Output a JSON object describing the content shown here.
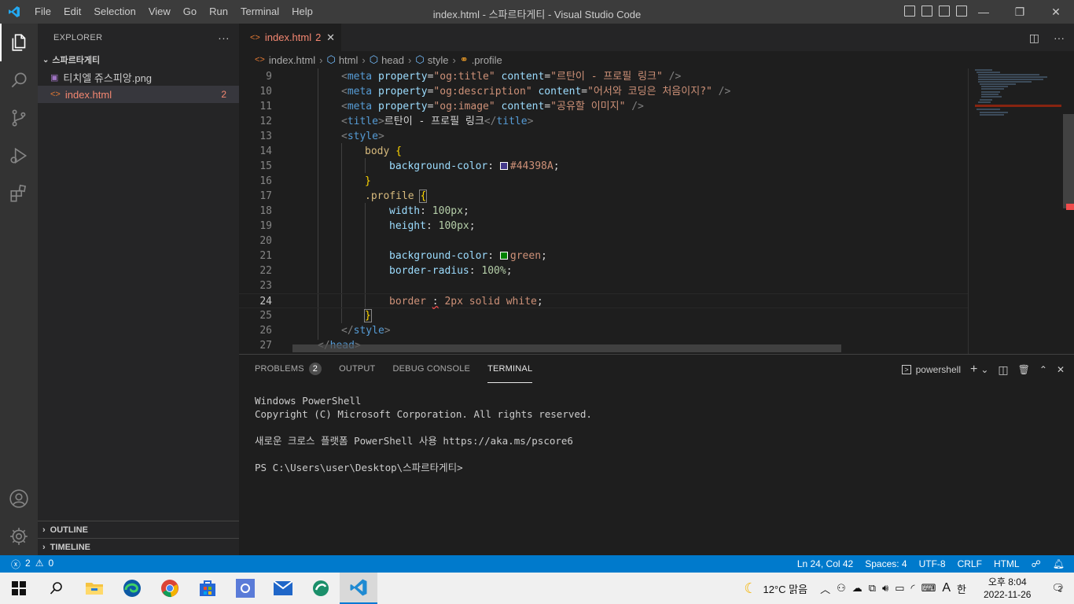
{
  "titlebar": {
    "menu": [
      "File",
      "Edit",
      "Selection",
      "View",
      "Go",
      "Run",
      "Terminal",
      "Help"
    ],
    "title": "index.html - 스파르타게티 - Visual Studio Code"
  },
  "sidebar": {
    "header": "EXPLORER",
    "more": "···",
    "folder": "스파르타게티",
    "files": [
      {
        "name": "티치엘 쥬스피앙.png",
        "badge": ""
      },
      {
        "name": "index.html",
        "badge": "2"
      }
    ],
    "outline": "OUTLINE",
    "timeline": "TIMELINE"
  },
  "tab": {
    "label": "index.html",
    "badge": "2"
  },
  "breadcrumb": [
    "index.html",
    "html",
    "head",
    "style",
    ".profile"
  ],
  "editor": {
    "lines": [
      {
        "n": "9"
      },
      {
        "n": "10"
      },
      {
        "n": "11"
      },
      {
        "n": "12"
      },
      {
        "n": "13"
      },
      {
        "n": "14"
      },
      {
        "n": "15"
      },
      {
        "n": "16"
      },
      {
        "n": "17"
      },
      {
        "n": "18"
      },
      {
        "n": "19"
      },
      {
        "n": "20"
      },
      {
        "n": "21"
      },
      {
        "n": "22"
      },
      {
        "n": "23"
      },
      {
        "n": "24"
      },
      {
        "n": "25"
      },
      {
        "n": "26"
      },
      {
        "n": "27"
      }
    ],
    "og_title": "\"르탄이 - 프로필 링크\"",
    "og_desc": "\"어서와 코딩은 처음이지?\"",
    "og_image": "\"공유할 이미지\"",
    "title_text": "르탄이 - 프로필 링크",
    "bg_color": "#44398A",
    "green": "green",
    "w100": "100px",
    "h100": "100px",
    "radius": "100%",
    "border_val": "2px solid white"
  },
  "colors": {
    "swatch1": "#44398A",
    "swatch2": "#008000"
  },
  "panel": {
    "tabs": [
      "PROBLEMS",
      "OUTPUT",
      "DEBUG CONSOLE",
      "TERMINAL"
    ],
    "problems_count": "2",
    "shell": "powershell",
    "terminal": [
      "Windows PowerShell",
      "Copyright (C) Microsoft Corporation. All rights reserved.",
      "",
      "새로운 크로스 플랫폼 PowerShell 사용 https://aka.ms/pscore6",
      "",
      "PS C:\\Users\\user\\Desktop\\스파르타게티>"
    ]
  },
  "status": {
    "errors": "2",
    "warnings": "0",
    "position": "Ln 24, Col 42",
    "spaces": "Spaces: 4",
    "encoding": "UTF-8",
    "eol": "CRLF",
    "lang": "HTML"
  },
  "taskbar": {
    "weather": "12°C  맑음",
    "ime": "A",
    "ime2": "한",
    "time": "오후 8:04",
    "date": "2022-11-26",
    "notif": "2"
  }
}
